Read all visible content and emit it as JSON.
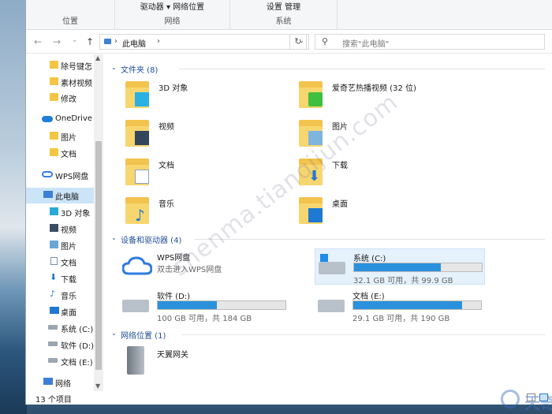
{
  "ribbon": {
    "groups": [
      {
        "label": "位置",
        "commands": ""
      },
      {
        "label": "网络",
        "commands": "驱动器 ▾ 网络位置"
      },
      {
        "label": "系统",
        "commands": "设置  管理"
      }
    ]
  },
  "address": {
    "path": "此电脑",
    "search_placeholder": "搜索\"此电脑\""
  },
  "sidebar": {
    "items": [
      {
        "label": "除号键怎",
        "icon": "folder-icon"
      },
      {
        "label": "素材视频",
        "icon": "folder-icon"
      },
      {
        "label": "修改",
        "icon": "folder-icon"
      },
      {
        "label": "OneDrive",
        "icon": "cloud-icon"
      },
      {
        "label": "图片",
        "icon": "folder-icon"
      },
      {
        "label": "文档",
        "icon": "folder-icon"
      },
      {
        "label": "WPS网盘",
        "icon": "wps-cloud-icon"
      },
      {
        "label": "此电脑",
        "icon": "computer-icon"
      },
      {
        "label": "3D 对象",
        "icon": "cube-icon"
      },
      {
        "label": "视频",
        "icon": "film-icon"
      },
      {
        "label": "图片",
        "icon": "picture-icon"
      },
      {
        "label": "文档",
        "icon": "document-icon"
      },
      {
        "label": "下载",
        "icon": "download-icon"
      },
      {
        "label": "音乐",
        "icon": "music-icon"
      },
      {
        "label": "桌面",
        "icon": "desktop-icon"
      },
      {
        "label": "系统 (C:)",
        "icon": "drive-icon"
      },
      {
        "label": "软件 (D:)",
        "icon": "drive-icon"
      },
      {
        "label": "文档 (E:)",
        "icon": "drive-icon"
      },
      {
        "label": "网络",
        "icon": "network-icon"
      }
    ]
  },
  "sections": {
    "folders": "文件夹 (8)",
    "devices": "设备和驱动器 (4)",
    "network": "网络位置 (1)"
  },
  "folders": [
    {
      "name": "3D 对象",
      "icon": "cube-icon"
    },
    {
      "name": "爱奇艺热播视频 (32 位)",
      "icon": "iqiyi-icon"
    },
    {
      "name": "视频",
      "icon": "film-icon"
    },
    {
      "name": "图片",
      "icon": "picture-icon"
    },
    {
      "name": "文档",
      "icon": "document-icon"
    },
    {
      "name": "下载",
      "icon": "download-icon"
    },
    {
      "name": "音乐",
      "icon": "music-icon"
    },
    {
      "name": "桌面",
      "icon": "desktop-icon"
    }
  ],
  "drives": [
    {
      "name": "WPS网盘",
      "sub": "双击进入WPS网盘"
    },
    {
      "name": "系统 (C:)",
      "info": "32.1 GB 可用，共 99.9 GB",
      "used_fraction": 0.68
    },
    {
      "name": "软件 (D:)",
      "info": "100 GB 可用，共 184 GB",
      "used_fraction": 0.46
    },
    {
      "name": "文档 (E:)",
      "info": "29.1 GB 可用，共 190 GB",
      "used_fraction": 0.85
    }
  ],
  "network_items": [
    {
      "name": "天翼网关",
      "icon": "gateway-icon"
    }
  ],
  "status": {
    "count": "13 个项目"
  },
  "watermark": "shenma.tianqijun.com",
  "logo_text": "天奇·数码",
  "colors": {
    "accent": "#2b91dd",
    "selection": "#cce4f7",
    "section_text": "#1e4f98"
  }
}
